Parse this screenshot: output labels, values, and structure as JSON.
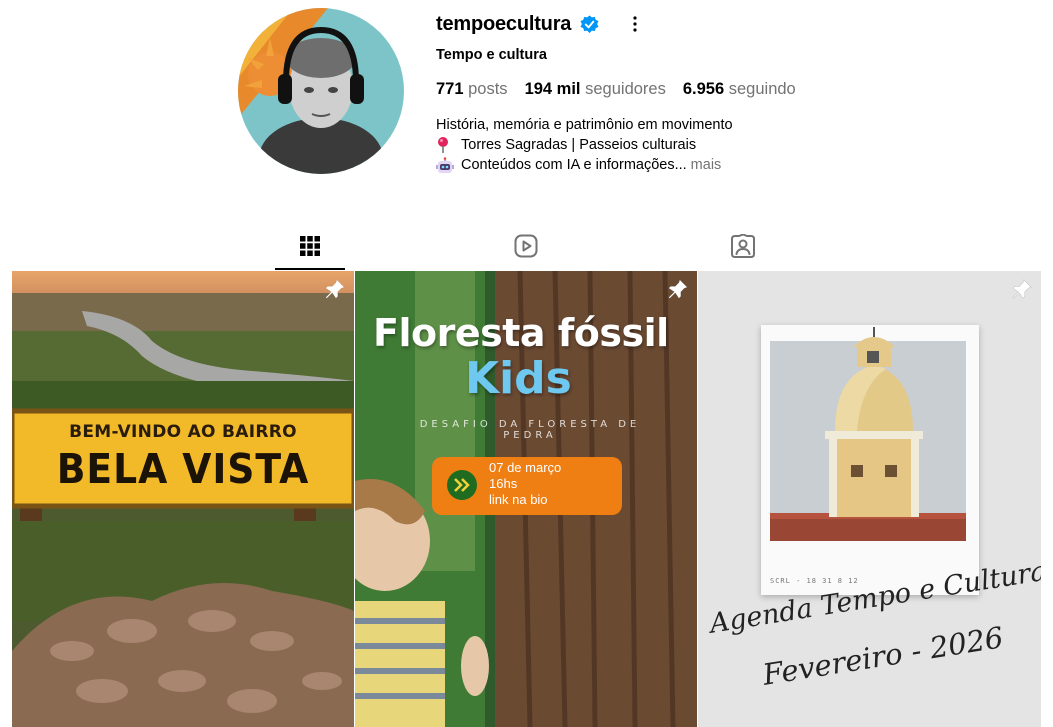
{
  "profile": {
    "username": "tempoecultura",
    "full_name": "Tempo e cultura",
    "verified": true,
    "stats": {
      "posts_value": "771",
      "posts_label": "posts",
      "followers_value": "194 mil",
      "followers_label": "seguidores",
      "following_value": "6.956",
      "following_label": "seguindo"
    },
    "bio": {
      "line1": "História, memória e patrimônio em movimento",
      "line2": "Torres Sagradas | Passeios culturais",
      "line3": "Conteúdos com IA e informações...",
      "more_label": "mais"
    },
    "icons": {
      "verified": "verified-badge-icon",
      "options": "more-options-icon",
      "pin": "round-pushpin-emoji",
      "robot": "robot-emoji"
    }
  },
  "tabs": [
    {
      "name": "posts-grid",
      "icon": "grid-icon",
      "active": true
    },
    {
      "name": "reels",
      "icon": "reels-icon",
      "active": false
    },
    {
      "name": "tagged",
      "icon": "tagged-icon",
      "active": false
    }
  ],
  "posts": [
    {
      "pinned": true,
      "sign_line1": "BEM-VINDO AO BAIRRO",
      "sign_line2": "BELA VISTA"
    },
    {
      "pinned": true,
      "title_line1": "Floresta fóssil",
      "title_line2": "Kids",
      "subtitle": "DESAFIO DA FLORESTA DE PEDRA",
      "event_info": "07 de março\n16hs\nlink na bio"
    },
    {
      "pinned": true,
      "caption_small": "SCRL - 18 31 8 12",
      "title_line1": "Agenda Tempo e Cultura",
      "title_line2": "Fevereiro - 2026"
    }
  ],
  "colors": {
    "accent_blue": "#0095f6",
    "muted_text": "#737373",
    "badge_orange": "#f07f13",
    "kids_blue": "#6ec8ef"
  }
}
